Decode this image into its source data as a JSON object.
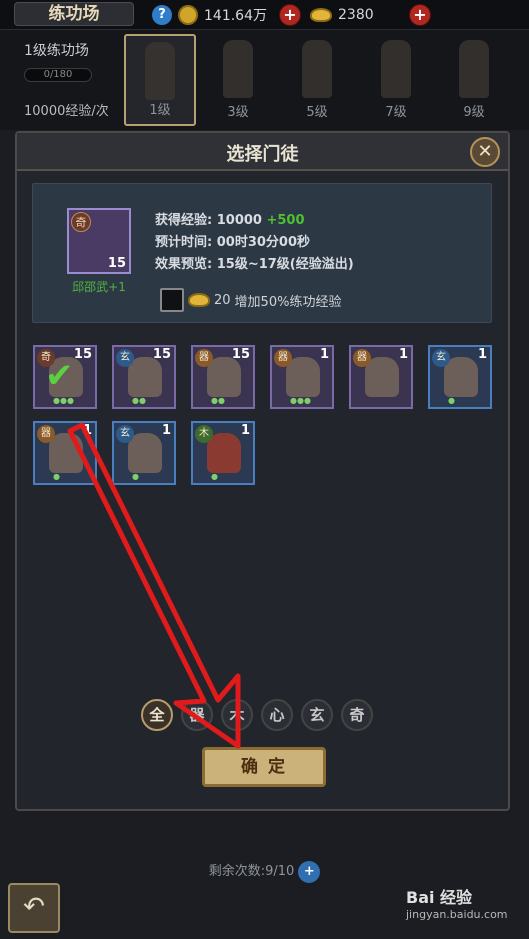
{
  "header": {
    "title": "练功场",
    "silver_value": "141.64万",
    "gold_value": "2380"
  },
  "levels": {
    "current_name": "1级练功场",
    "progress_text": "0/180",
    "exp_rate": "10000经验/次",
    "items": [
      {
        "label": "1级"
      },
      {
        "label": "3级"
      },
      {
        "label": "5级"
      },
      {
        "label": "7级"
      },
      {
        "label": "9级"
      }
    ]
  },
  "dialog": {
    "title": "选择门徒",
    "selected_hero": {
      "badge": "奇",
      "level": "15",
      "name": "邱邵武+1"
    },
    "info": {
      "exp_label": "获得经验: 10000",
      "exp_bonus": "+500",
      "time_label": "预计时间: 00时30分00秒",
      "preview_label": "效果预览: 15级~17级(经验溢出)"
    },
    "boost": {
      "cost": "20",
      "text": "增加50%练功经验"
    },
    "heroes": [
      {
        "badge": "奇",
        "level": "15",
        "checked": true
      },
      {
        "badge": "玄",
        "level": "15"
      },
      {
        "badge": "器",
        "level": "15"
      },
      {
        "badge": "器",
        "level": "1"
      },
      {
        "badge": "器",
        "level": "1"
      },
      {
        "badge": "玄",
        "level": "1"
      },
      {
        "badge": "器",
        "level": "1"
      },
      {
        "badge": "玄",
        "level": "1"
      },
      {
        "badge": "木",
        "level": "1"
      }
    ],
    "filters": [
      "全",
      "器",
      "木",
      "心",
      "玄",
      "奇"
    ],
    "confirm_label": "确 定"
  },
  "footer": {
    "remaining": "剩余次数:9/10"
  },
  "watermark": {
    "brand": "Bai 经验",
    "url": "jingyan.baidu.com"
  },
  "colors": {
    "confirm_bg": "#cbb27a",
    "arrow": "#e01b1b",
    "bonus_green": "#4ec032"
  }
}
